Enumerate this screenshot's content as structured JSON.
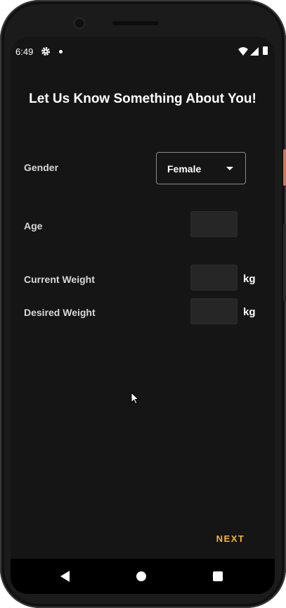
{
  "status_bar": {
    "time": "6:49",
    "icons": [
      "gear-icon",
      "notification-dot-icon",
      "wifi-icon",
      "signal-icon",
      "battery-icon"
    ]
  },
  "page": {
    "title": "Let Us Know Something About You!"
  },
  "form": {
    "gender": {
      "label": "Gender",
      "selected": "Female"
    },
    "age": {
      "label": "Age",
      "value": ""
    },
    "current_weight": {
      "label": "Current Weight",
      "value": "",
      "unit": "kg"
    },
    "desired_weight": {
      "label": "Desired Weight",
      "value": "",
      "unit": "kg"
    }
  },
  "actions": {
    "next_label": "NEXT"
  },
  "nav_bar": {
    "icons": [
      "back-icon",
      "home-icon",
      "recents-icon"
    ]
  },
  "colors": {
    "background": "#151515",
    "accent": "#f2b927",
    "input_fill": "#262626",
    "text": "#ffffff"
  }
}
